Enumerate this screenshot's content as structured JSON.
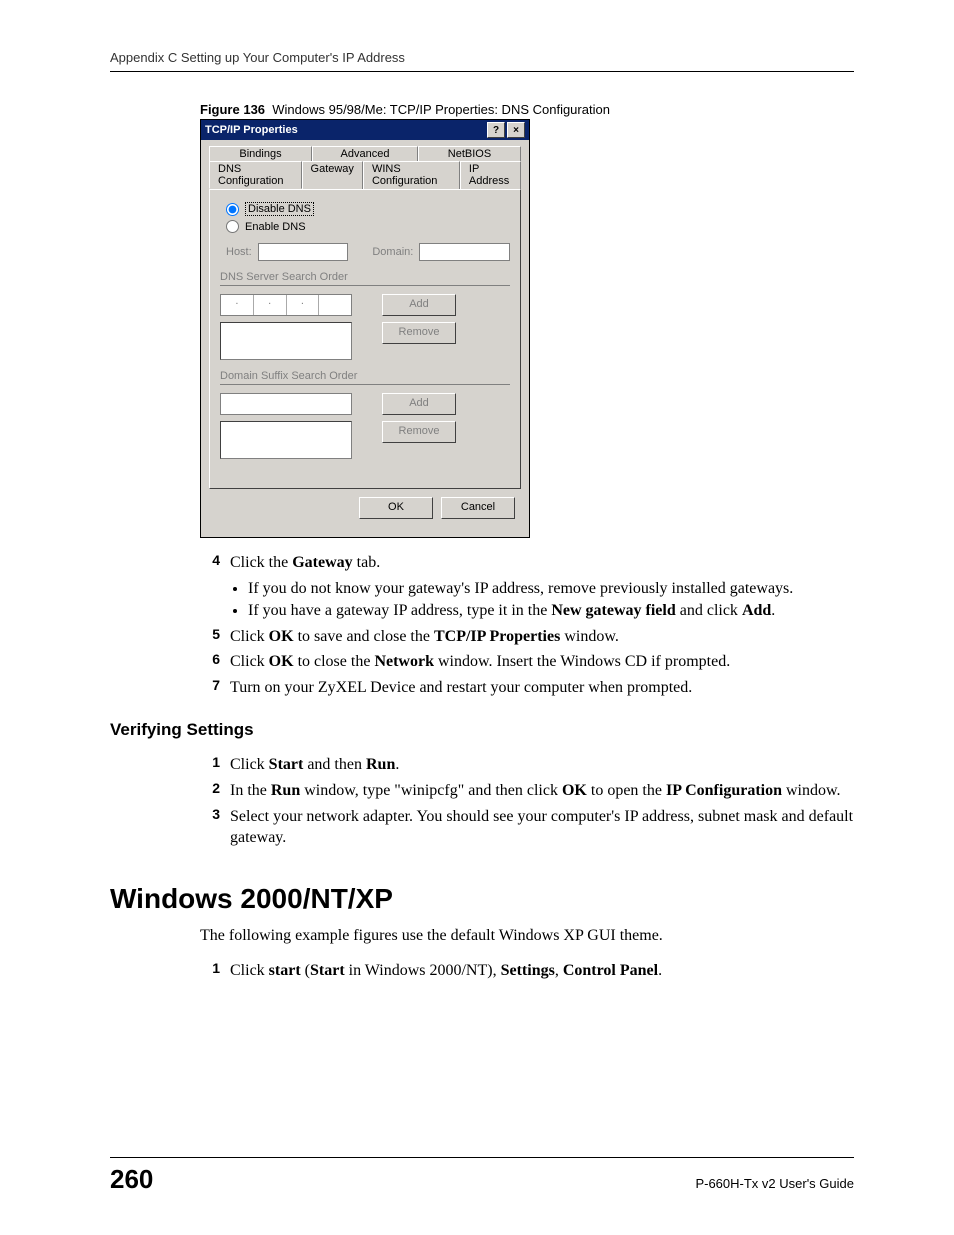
{
  "header": "Appendix C Setting up Your Computer's IP Address",
  "figure": {
    "label": "Figure 136",
    "caption": "Windows 95/98/Me: TCP/IP Properties: DNS Configuration"
  },
  "dialog": {
    "title": "TCP/IP Properties",
    "help_btn": "?",
    "close_btn": "×",
    "tabs_row1": [
      "Bindings",
      "Advanced",
      "NetBIOS"
    ],
    "tabs_row2": [
      "DNS Configuration",
      "Gateway",
      "WINS Configuration",
      "IP Address"
    ],
    "radio_disable": "Disable DNS",
    "radio_enable": "Enable DNS",
    "host_label": "Host:",
    "domain_label": "Domain:",
    "group1_label": "DNS Server Search Order",
    "group2_label": "Domain Suffix Search Order",
    "add_btn": "Add",
    "remove_btn": "Remove",
    "ok_btn": "OK",
    "cancel_btn": "Cancel"
  },
  "steps_a": [
    {
      "num": "4",
      "html": "Click the <b>Gateway</b> tab."
    },
    {
      "num": "5",
      "html": "Click <b>OK</b> to save and close the <b>TCP/IP Properties</b> window."
    },
    {
      "num": "6",
      "html": "Click <b>OK</b> to close the <b>Network</b> window. Insert the Windows CD if prompted."
    },
    {
      "num": "7",
      "html": "Turn on your ZyXEL Device and restart your computer when prompted."
    }
  ],
  "bullets_4": [
    "If you do not know your gateway's IP address, remove previously installed gateways.",
    "If you have a gateway IP address, type it in the <b>New gateway field</b> and click <b>Add</b>."
  ],
  "section_verify": "Verifying Settings",
  "steps_b": [
    {
      "num": "1",
      "html": "Click <b>Start</b> and then <b>Run</b>."
    },
    {
      "num": "2",
      "html": "In the <b>Run</b> window, type \"winipcfg\" and then click <b>OK</b> to open the <b>IP Configuration</b> window."
    },
    {
      "num": "3",
      "html": "Select your network adapter. You should see your computer's IP address, subnet mask and default gateway."
    }
  ],
  "big_heading": "Windows 2000/NT/XP",
  "para_xp": "The following example figures use the default Windows XP GUI theme.",
  "steps_c": [
    {
      "num": "1",
      "html": "Click <b>start</b> (<b>Start</b> in Windows 2000/NT), <b>Settings</b>, <b>Control Panel</b>."
    }
  ],
  "footer": {
    "page": "260",
    "guide": "P-660H-Tx v2 User's Guide"
  }
}
